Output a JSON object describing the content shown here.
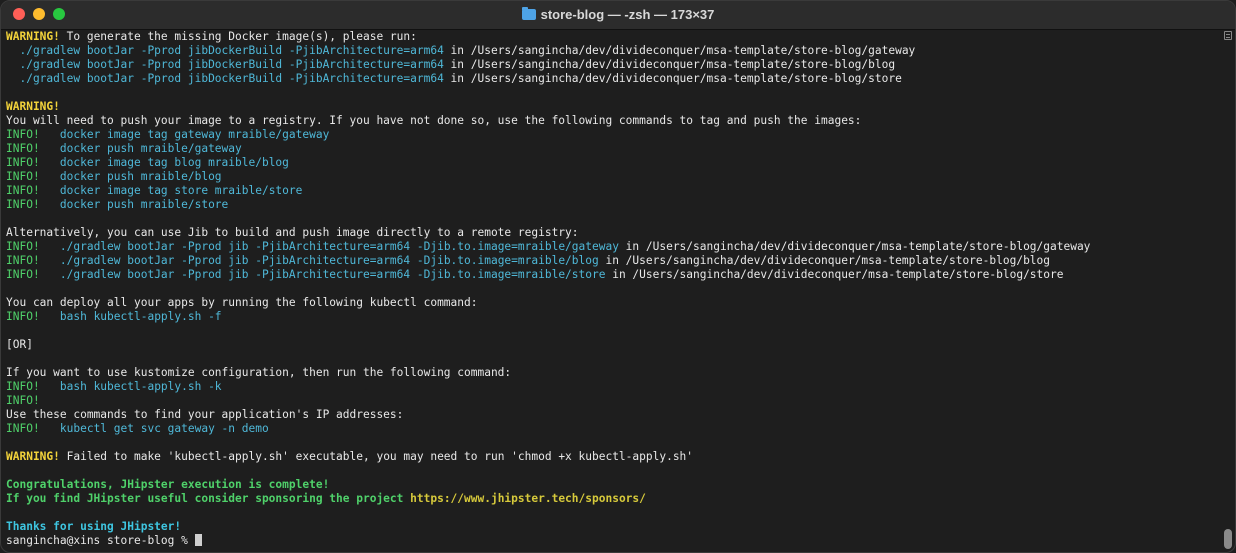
{
  "window": {
    "title": "store-blog — -zsh — 173×37"
  },
  "lines": [
    [
      {
        "t": "WARNING!",
        "c": "warn"
      },
      {
        "t": " To generate the missing Docker image(s), please run:"
      }
    ],
    [
      {
        "t": "  ./gradlew bootJar -Pprod jibDockerBuild -PjibArchitecture=arm64",
        "c": "cmd"
      },
      {
        "t": " in /Users/sangincha/dev/divideconquer/msa-template/store-blog/gateway"
      }
    ],
    [
      {
        "t": "  ./gradlew bootJar -Pprod jibDockerBuild -PjibArchitecture=arm64",
        "c": "cmd"
      },
      {
        "t": " in /Users/sangincha/dev/divideconquer/msa-template/store-blog/blog"
      }
    ],
    [
      {
        "t": "  ./gradlew bootJar -Pprod jibDockerBuild -PjibArchitecture=arm64",
        "c": "cmd"
      },
      {
        "t": " in /Users/sangincha/dev/divideconquer/msa-template/store-blog/store"
      }
    ],
    [],
    [
      {
        "t": "WARNING!",
        "c": "warn"
      }
    ],
    [
      {
        "t": "You will need to push your image to a registry. If you have not done so, use the following commands to tag and push the images:"
      }
    ],
    [
      {
        "t": "INFO!",
        "c": "info"
      },
      {
        "t": "   docker image tag gateway mraible/gateway",
        "c": "cmd"
      }
    ],
    [
      {
        "t": "INFO!",
        "c": "info"
      },
      {
        "t": "   docker push mraible/gateway",
        "c": "cmd"
      }
    ],
    [
      {
        "t": "INFO!",
        "c": "info"
      },
      {
        "t": "   docker image tag blog mraible/blog",
        "c": "cmd"
      }
    ],
    [
      {
        "t": "INFO!",
        "c": "info"
      },
      {
        "t": "   docker push mraible/blog",
        "c": "cmd"
      }
    ],
    [
      {
        "t": "INFO!",
        "c": "info"
      },
      {
        "t": "   docker image tag store mraible/store",
        "c": "cmd"
      }
    ],
    [
      {
        "t": "INFO!",
        "c": "info"
      },
      {
        "t": "   docker push mraible/store",
        "c": "cmd"
      }
    ],
    [],
    [
      {
        "t": "Alternatively, you can use Jib to build and push image directly to a remote registry:"
      }
    ],
    [
      {
        "t": "INFO!",
        "c": "info"
      },
      {
        "t": "   ./gradlew bootJar -Pprod jib -PjibArchitecture=arm64 -Djib.to.image=mraible/gateway",
        "c": "cmd"
      },
      {
        "t": " in /Users/sangincha/dev/divideconquer/msa-template/store-blog/gateway"
      }
    ],
    [
      {
        "t": "INFO!",
        "c": "info"
      },
      {
        "t": "   ./gradlew bootJar -Pprod jib -PjibArchitecture=arm64 -Djib.to.image=mraible/blog",
        "c": "cmd"
      },
      {
        "t": " in /Users/sangincha/dev/divideconquer/msa-template/store-blog/blog"
      }
    ],
    [
      {
        "t": "INFO!",
        "c": "info"
      },
      {
        "t": "   ./gradlew bootJar -Pprod jib -PjibArchitecture=arm64 -Djib.to.image=mraible/store",
        "c": "cmd"
      },
      {
        "t": " in /Users/sangincha/dev/divideconquer/msa-template/store-blog/store"
      }
    ],
    [],
    [
      {
        "t": "You can deploy all your apps by running the following kubectl command:"
      }
    ],
    [
      {
        "t": "INFO!",
        "c": "info"
      },
      {
        "t": "   bash kubectl-apply.sh -f",
        "c": "cmd"
      }
    ],
    [],
    [
      {
        "t": "[OR]"
      }
    ],
    [],
    [
      {
        "t": "If you want to use kustomize configuration, then run the following command:"
      }
    ],
    [
      {
        "t": "INFO!",
        "c": "info"
      },
      {
        "t": "   bash kubectl-apply.sh -k",
        "c": "cmd"
      }
    ],
    [
      {
        "t": "INFO!",
        "c": "info"
      }
    ],
    [
      {
        "t": "Use these commands to find your application's IP addresses:"
      }
    ],
    [
      {
        "t": "INFO!",
        "c": "info"
      },
      {
        "t": "   kubectl get svc gateway -n demo",
        "c": "cmd"
      }
    ],
    [],
    [
      {
        "t": "WARNING!",
        "c": "warn"
      },
      {
        "t": " Failed to make 'kubectl-apply.sh' executable, you may need to run 'chmod +x kubectl-apply.sh'"
      }
    ],
    [],
    [
      {
        "t": "Congratulations, JHipster execution is complete!",
        "c": "green-bold"
      }
    ],
    [
      {
        "t": "If you find JHipster useful consider sponsoring the project ",
        "c": "green-bold"
      },
      {
        "t": "https://www.jhipster.tech/sponsors/",
        "c": "yellow-bold"
      }
    ],
    [],
    [
      {
        "t": "Thanks for using JHipster!",
        "c": "cyan-bold"
      }
    ],
    [
      {
        "t": "sangincha@xins store-blog % "
      },
      {
        "cursor": true
      }
    ]
  ]
}
